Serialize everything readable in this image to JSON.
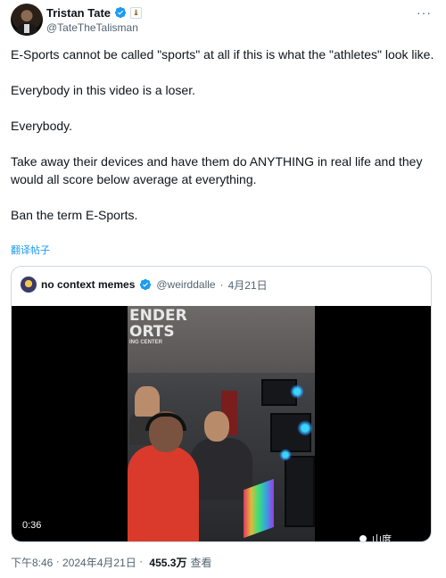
{
  "author": {
    "display_name": "Tristan Tate",
    "handle": "@TateTheTalisman",
    "verified_color": "#1d9bf0",
    "affiliate_icon": "affiliate-badge-icon"
  },
  "tweet": {
    "paragraphs": [
      "E-Sports cannot be called \"sports\" at all if this is what the \"athletes\" look like.",
      "Everybody in this video is a loser.",
      "Everybody.",
      "Take away their devices and have them do ANYTHING in real life and they would all score below average at everything.",
      "Ban the term E-Sports."
    ],
    "translate_label": "翻译帖子"
  },
  "quote": {
    "display_name": "no context memes",
    "handle": "@weirddalle",
    "separator": "·",
    "date": "4月21日",
    "video": {
      "duration": "0:36",
      "sign_text": "ENDER\nORTS",
      "sign_small": "ING CENTER",
      "watermark": "山度"
    }
  },
  "meta": {
    "time": "下午8:46",
    "dot1": " · ",
    "date": "2024年4月21日",
    "dot2": " · ",
    "views": "455.3万",
    "views_label": "查看"
  },
  "more_label": "···"
}
